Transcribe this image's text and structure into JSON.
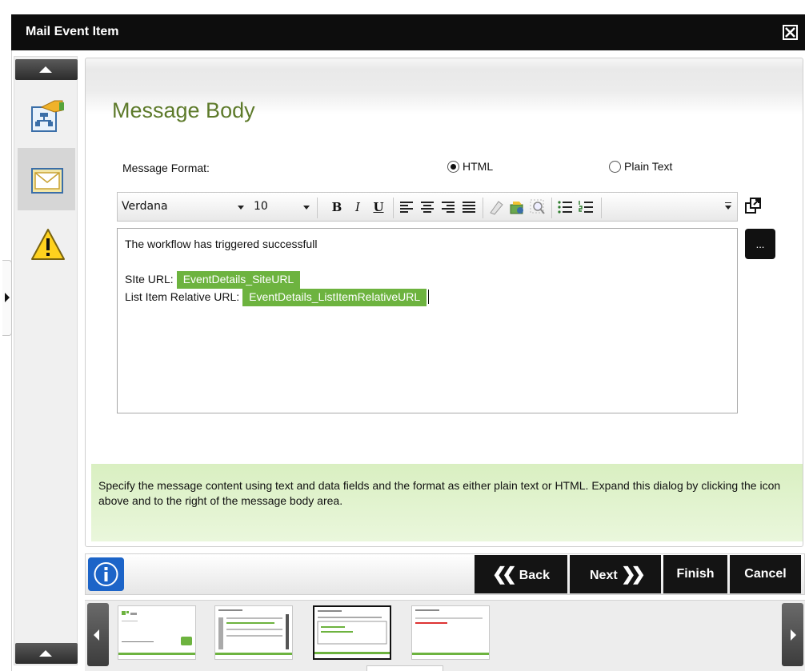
{
  "window": {
    "title": "Mail Event Item"
  },
  "rail": {
    "items": [
      {
        "name": "destination-users-icon"
      },
      {
        "name": "message-mail-icon"
      },
      {
        "name": "warning-icon"
      }
    ]
  },
  "main": {
    "title": "Message Body",
    "format_label": "Message Format:",
    "format_options": [
      {
        "label": "HTML",
        "selected": true
      },
      {
        "label": "Plain Text",
        "selected": false
      }
    ],
    "toolbar": {
      "font": "Verdana",
      "size": "10",
      "bold": "B",
      "italic": "I",
      "underline": "U"
    },
    "editor": {
      "line1": "The workflow has triggered successfull",
      "site_label": "SIte URL:",
      "site_field": "EventDetails_SiteURL",
      "list_label": "List Item Relative URL:",
      "list_field": "EventDetails_ListItemRelativeURL"
    },
    "ellipsis_label": "...",
    "hint": "Specify the message content using text and data fields and the format as either plain text or HTML. Expand this dialog by clicking the icon above and to the right of the message body area."
  },
  "nav": {
    "back": "Back",
    "next": "Next",
    "finish": "Finish",
    "cancel": "Cancel"
  },
  "colors": {
    "accent_green": "#6db33f",
    "title_green": "#5d7a2a",
    "info_blue": "#1c64c8"
  }
}
